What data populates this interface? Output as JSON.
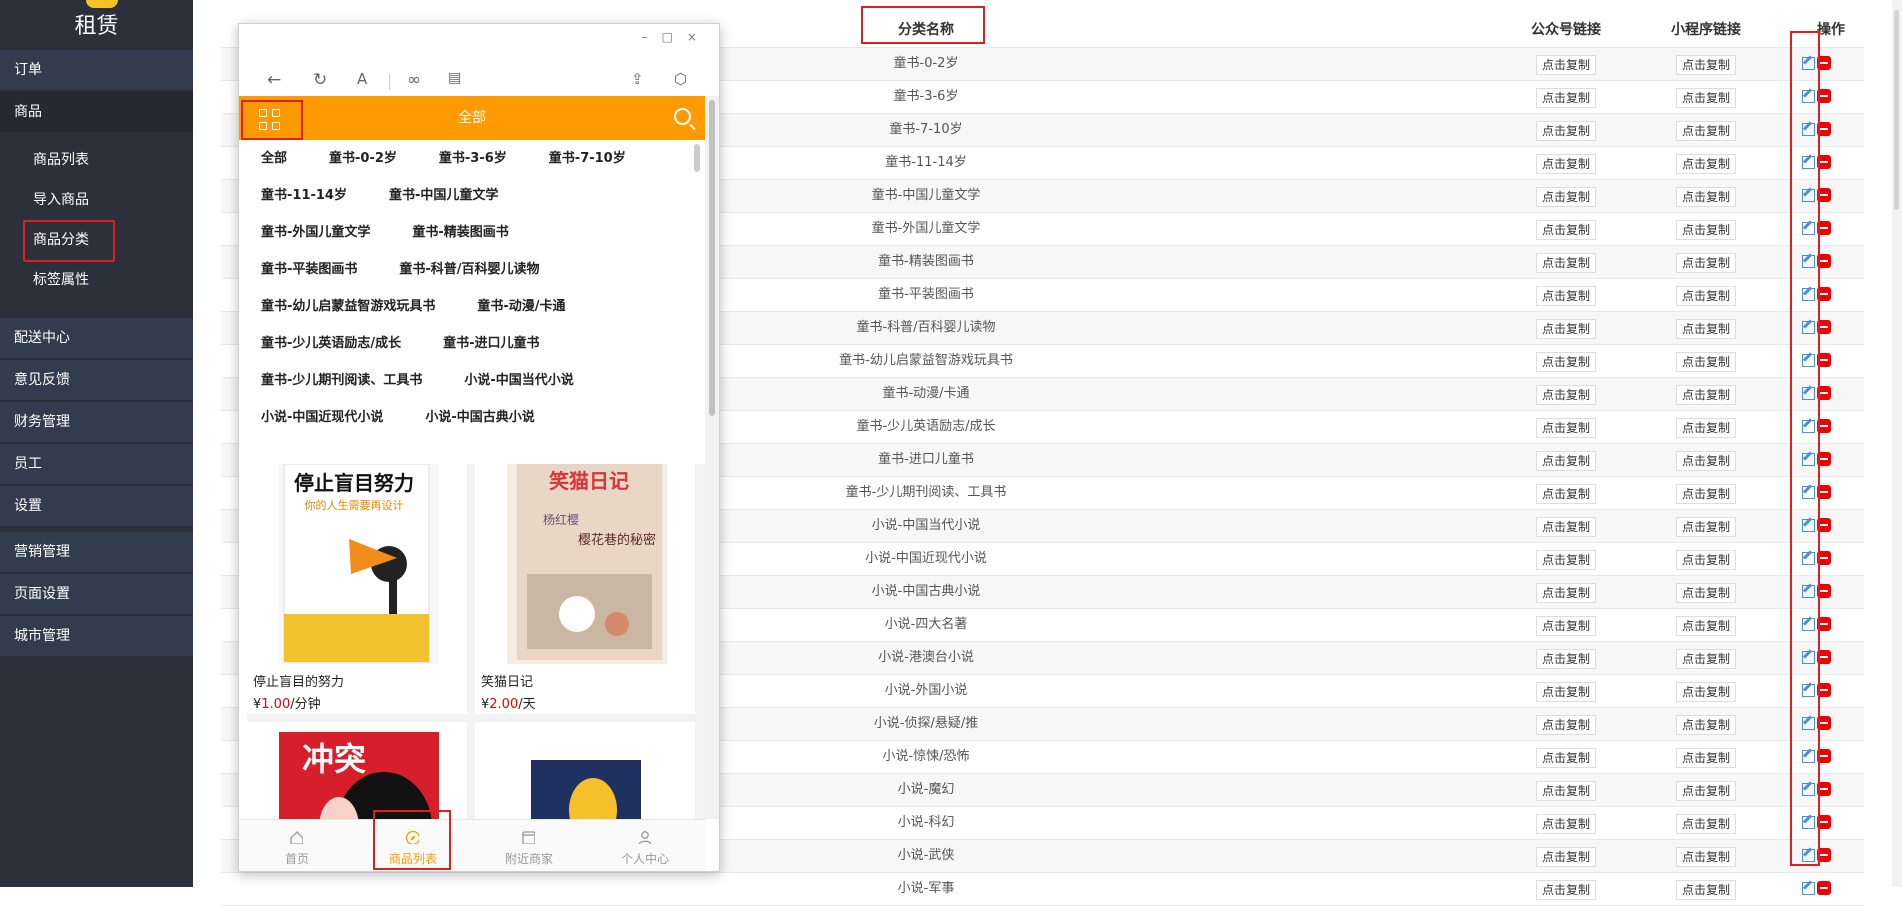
{
  "sidebar": {
    "brand": "租赁",
    "top_items": [
      "订单",
      "商品"
    ],
    "sub_items": [
      "商品列表",
      "导入商品",
      "商品分类",
      "标签属性"
    ],
    "bottom_items": [
      "配送中心",
      "意见反馈",
      "财务管理",
      "员工",
      "设置",
      "营销管理",
      "页面设置",
      "城市管理"
    ]
  },
  "table": {
    "headers": {
      "name": "分类名称",
      "gzh": "公众号链接",
      "mp": "小程序链接",
      "op": "操作"
    },
    "copy_label": "点击复制",
    "rows": [
      "童书-0-2岁",
      "童书-3-6岁",
      "童书-7-10岁",
      "童书-11-14岁",
      "童书-中国儿童文学",
      "童书-外国儿童文学",
      "童书-精装图画书",
      "童书-平装图画书",
      "童书-科普/百科婴儿读物",
      "童书-幼儿启蒙益智游戏玩具书",
      "童书-动漫/卡通",
      "童书-少儿英语励志/成长",
      "童书-进口儿童书",
      "童书-少儿期刊阅读、工具书",
      "小说-中国当代小说",
      "小说-中国近现代小说",
      "小说-中国古典小说",
      "小说-四大名著",
      "小说-港澳台小说",
      "小说-外国小说",
      "小说-侦探/悬疑/推",
      "小说-惊悚/恐怖",
      "小说-魔幻",
      "小说-科幻",
      "小说-武侠",
      "小说-军事"
    ]
  },
  "phone": {
    "window_controls": "–□×",
    "toolbar_icons": [
      "back-icon",
      "refresh-icon",
      "font-icon",
      "link-icon",
      "layout-icon",
      "share-icon",
      "package-icon"
    ],
    "header_title": "全部",
    "category_lines": [
      [
        "全部",
        "童书-0-2岁",
        "童书-3-6岁",
        "童书-7-10岁"
      ],
      [
        "童书-11-14岁",
        "童书-中国儿童文学"
      ],
      [
        "童书-外国儿童文学",
        "童书-精装图画书"
      ],
      [
        "童书-平装图画书",
        "童书-科普/百科婴儿读物"
      ],
      [
        "童书-幼儿启蒙益智游戏玩具书",
        "童书-动漫/卡通"
      ],
      [
        "童书-少儿英语励志/成长",
        "童书-进口儿童书"
      ],
      [
        "童书-少儿期刊阅读、工具书",
        "小说-中国当代小说"
      ],
      [
        "小说-中国近现代小说",
        "小说-中国古典小说"
      ]
    ],
    "products": [
      {
        "title": "停止盲目的努力",
        "price_symbol": "¥",
        "price": "1.00",
        "unit": "/分钟",
        "cover_title": "停止盲目努力",
        "cover_subtitle": "你的人生需要再设计"
      },
      {
        "title": "笑猫日记",
        "price_symbol": "¥",
        "price": "2.00",
        "unit": "/天",
        "cover_title": "笑猫日记",
        "cover_subtitle": "樱花巷的秘密",
        "cover_author": "杨红樱"
      },
      {
        "cover_title": "冲突"
      },
      {
        "cover_title": ""
      }
    ],
    "bottom_nav": [
      "首页",
      "商品列表",
      "附近商家",
      "个人中心"
    ]
  },
  "colors": {
    "accent": "#ff9a00",
    "sidebar_bg": "#2b303b",
    "highlight_red": "#e02020",
    "price_red": "#e00000"
  }
}
